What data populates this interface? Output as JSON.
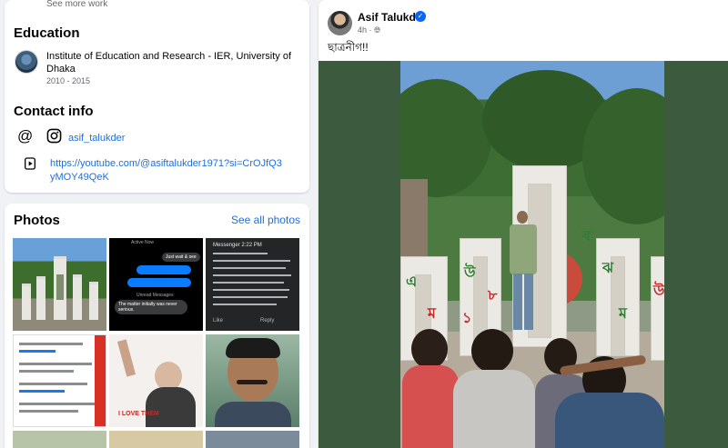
{
  "intro": {
    "see_more_work": "See more work"
  },
  "education": {
    "title": "Education",
    "institution": "Institute of Education and Research - IER, University of Dhaka",
    "years": "2010 - 2015"
  },
  "contact": {
    "title": "Contact info",
    "instagram": "asif_talukder",
    "youtube": "https://youtube.com/@asiftalukder1971?si=CrOJfQ3yMOY49QeK"
  },
  "photos": {
    "title": "Photos",
    "see_all": "See all photos",
    "thumbs": [
      {
        "kind": "monument-photo"
      },
      {
        "kind": "chat-screenshot",
        "texts": [
          "Active Now",
          "Just wait & see",
          "The matter initially was never serious.",
          "Unread Messages"
        ]
      },
      {
        "kind": "comment-screenshot",
        "header": "Messenger 2:22 PM",
        "actions": [
          "Like",
          "Reply"
        ]
      },
      {
        "kind": "post-screenshot"
      },
      {
        "kind": "poster",
        "texts": [
          "I LOVE THEM"
        ]
      },
      {
        "kind": "selfie"
      }
    ]
  },
  "post": {
    "author": "Asif Talukder",
    "verified": true,
    "time": "4h",
    "privacy_icon": "globe-icon",
    "text": "ছাত্রনীগ!!"
  },
  "colors": {
    "link": "#216fdb",
    "verified": "#0866ff",
    "secondary_text": "#65676b",
    "page_bg": "#f0f2f5"
  }
}
